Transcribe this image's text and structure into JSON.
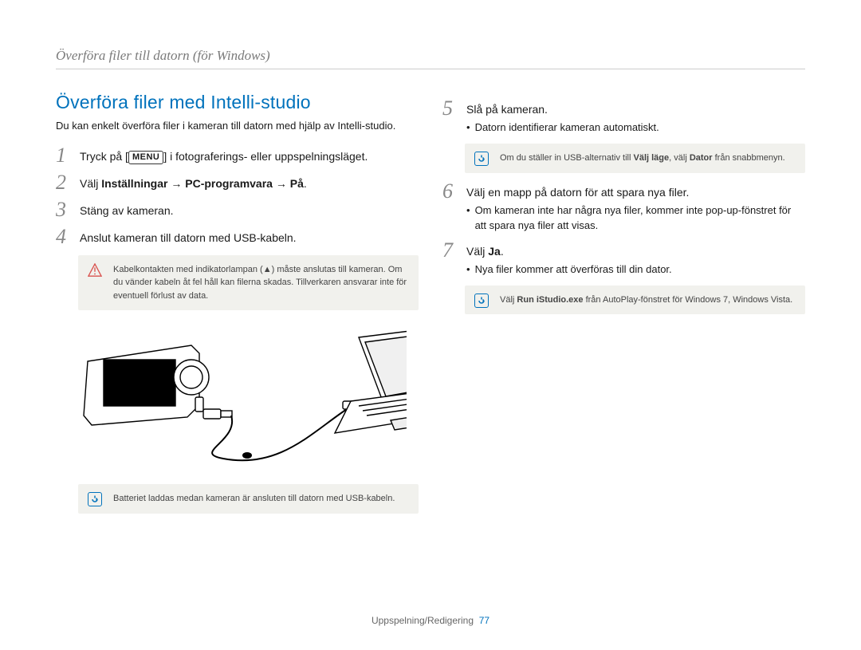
{
  "header": "Överföra filer till datorn (för Windows)",
  "heading": "Överföra filer med Intelli-studio",
  "intro": "Du kan enkelt överföra filer i kameran till datorn med hjälp av Intelli-studio.",
  "steps_left": {
    "s1": {
      "num": "1",
      "prefix": "Tryck på [",
      "menu": "MENU",
      "suffix": "] i fotograferings- eller uppspelningsläget."
    },
    "s2": {
      "num": "2",
      "prefix": "Välj ",
      "bold": "Inställningar → PC-programvara → På",
      "suffix": "."
    },
    "s3": {
      "num": "3",
      "text": "Stäng av kameran."
    },
    "s4": {
      "num": "4",
      "text": "Anslut kameran till datorn med USB-kabeln."
    }
  },
  "warn_note": "Kabelkontakten med indikatorlampan (▲) måste anslutas till kameran. Om du vänder kabeln åt fel håll kan filerna skadas. Tillverkaren ansvarar inte för eventuell förlust av data.",
  "battery_note": "Batteriet laddas medan kameran är ansluten till datorn med USB-kabeln.",
  "steps_right": {
    "s5": {
      "num": "5",
      "text": "Slå på kameran.",
      "bullet": "Datorn identifierar kameran automatiskt."
    },
    "s6": {
      "num": "6",
      "text": "Välj en mapp på datorn för att spara nya filer.",
      "bullet": "Om kameran inte har några nya filer, kommer inte pop-up-fönstret för att spara nya filer att visas."
    },
    "s7": {
      "num": "7",
      "prefix": "Välj ",
      "bold": "Ja",
      "suffix": ".",
      "bullet": "Nya filer kommer att överföras till din dator."
    }
  },
  "usb_note_prefix": "Om du ställer in USB-alternativ till ",
  "usb_note_bold1": "Välj läge",
  "usb_note_mid": ", välj ",
  "usb_note_bold2": "Dator",
  "usb_note_suffix": " från snabbmenyn.",
  "autoplay_note_prefix": "Välj ",
  "autoplay_note_bold": "Run iStudio.exe",
  "autoplay_note_suffix": " från AutoPlay-fönstret för Windows 7, Windows Vista.",
  "footer_label": "Uppspelning/Redigering",
  "footer_page": "77"
}
